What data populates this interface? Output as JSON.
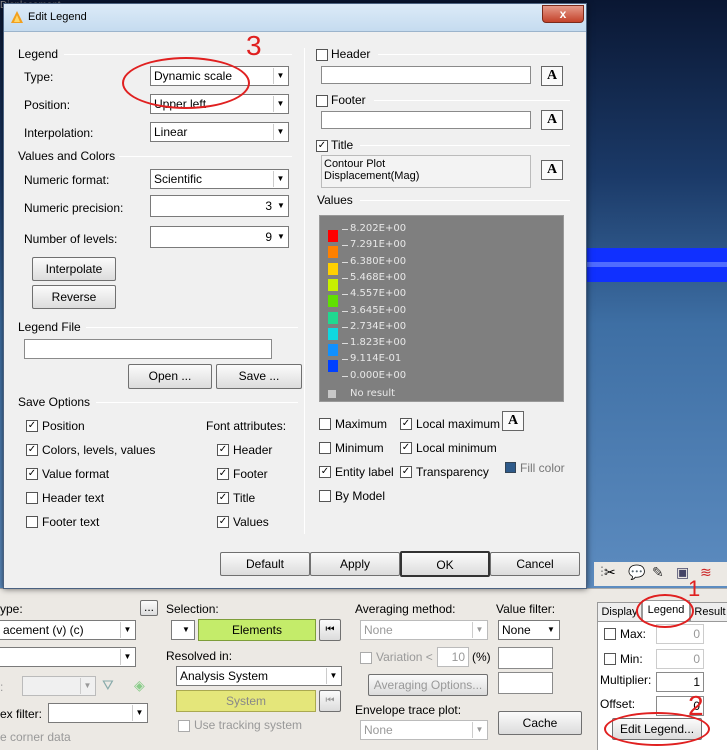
{
  "background": {
    "status_text": "Displacement",
    "toolbar_icons": [
      "scissors-icon",
      "chat-icon",
      "brush-icon",
      "camera-icon",
      "legend-icon"
    ]
  },
  "dialog": {
    "title": "Edit Legend",
    "close_label": "x",
    "legend_group": {
      "title": "Legend",
      "type_label": "Type:",
      "type_value": "Dynamic scale",
      "position_label": "Position:",
      "position_value": "Upper left",
      "interpolation_label": "Interpolation:",
      "interpolation_value": "Linear"
    },
    "values_colors": {
      "title": "Values and Colors",
      "numeric_format_label": "Numeric format:",
      "numeric_format_value": "Scientific",
      "numeric_precision_label": "Numeric precision:",
      "numeric_precision_value": "3",
      "levels_label": "Number of levels:",
      "levels_value": "9",
      "interpolate_button": "Interpolate",
      "reverse_button": "Reverse"
    },
    "legend_file": {
      "title": "Legend File",
      "path_value": "",
      "open_button": "Open ...",
      "save_button": "Save ..."
    },
    "save_options": {
      "title": "Save Options",
      "font_attributes_label": "Font attributes:",
      "left": [
        {
          "label": "Position",
          "checked": true
        },
        {
          "label": "Colors, levels, values",
          "checked": true
        },
        {
          "label": "Value format",
          "checked": true
        },
        {
          "label": "Header text",
          "checked": false
        },
        {
          "label": "Footer text",
          "checked": false
        }
      ],
      "right": [
        {
          "label": "Header",
          "checked": true
        },
        {
          "label": "Footer",
          "checked": true
        },
        {
          "label": "Title",
          "checked": true
        },
        {
          "label": "Values",
          "checked": true
        }
      ]
    },
    "header": {
      "label": "Header",
      "checked": false,
      "value": ""
    },
    "footer": {
      "label": "Footer",
      "checked": false,
      "value": ""
    },
    "title_opt": {
      "label": "Title",
      "checked": true,
      "line1": "Contour Plot",
      "line2": "Displacement(Mag)"
    },
    "font_button": "A",
    "values": {
      "title": "Values",
      "levels": [
        {
          "label": "8.202E+00",
          "color": "#ff0000"
        },
        {
          "label": "7.291E+00",
          "color": "#ff8000"
        },
        {
          "label": "6.380E+00",
          "color": "#ffd000"
        },
        {
          "label": "5.468E+00",
          "color": "#c8f000"
        },
        {
          "label": "4.557E+00",
          "color": "#60e000"
        },
        {
          "label": "3.645E+00",
          "color": "#20d890"
        },
        {
          "label": "2.734E+00",
          "color": "#10d8e0"
        },
        {
          "label": "1.823E+00",
          "color": "#1090ff"
        },
        {
          "label": "9.114E-01",
          "color": "#0040ff"
        },
        {
          "label": "0.000E+00",
          "color": "#0000c0"
        }
      ],
      "no_result_label": "No result",
      "no_result_color": "#c8c8c8"
    },
    "options": {
      "maximum": {
        "label": "Maximum",
        "checked": false
      },
      "local_maximum": {
        "label": "Local maximum",
        "checked": true
      },
      "minimum": {
        "label": "Minimum",
        "checked": false
      },
      "local_minimum": {
        "label": "Local minimum",
        "checked": true
      },
      "entity_label": {
        "label": "Entity label",
        "checked": true
      },
      "transparency": {
        "label": "Transparency",
        "checked": true
      },
      "fill_color": {
        "label": "Fill color",
        "color": "#2e5a8a"
      },
      "by_model": {
        "label": "By Model",
        "checked": false
      }
    },
    "buttons": {
      "default": "Default",
      "apply": "Apply",
      "ok": "OK",
      "cancel": "Cancel"
    }
  },
  "annotations": {
    "n1": "1",
    "n2": "2",
    "n3": "3"
  },
  "bottom": {
    "type_label": "ype:",
    "type_value": "acement (v) (c)",
    "ellipsis": "...",
    "second_value": "",
    "misc_label": ":",
    "ex_filter_label": "ex filter:",
    "corner_data_label": "e corner data",
    "selection_label": "Selection:",
    "elements_button": "Elements",
    "resolved_label": "Resolved in:",
    "resolved_value": "Analysis System",
    "system_button": "System",
    "tracking_label": "Use tracking system",
    "averaging_label": "Averaging method:",
    "averaging_value": "None",
    "variation_label": "Variation <",
    "variation_value": "10",
    "variation_unit": "(%)",
    "averaging_options_button": "Averaging Options...",
    "envelope_label": "Envelope trace plot:",
    "envelope_value": "None",
    "value_filter_label": "Value filter:",
    "value_filter_value": "None",
    "cache_button": "Cache",
    "tabs": [
      "Display",
      "Legend",
      "Result"
    ],
    "max_label": "Max:",
    "max_value": "0",
    "min_label": "Min:",
    "min_value": "0",
    "multiplier_label": "Multiplier:",
    "multiplier_value": "1",
    "offset_label": "Offset:",
    "offset_value": "0",
    "edit_legend_button": "Edit Legend..."
  }
}
